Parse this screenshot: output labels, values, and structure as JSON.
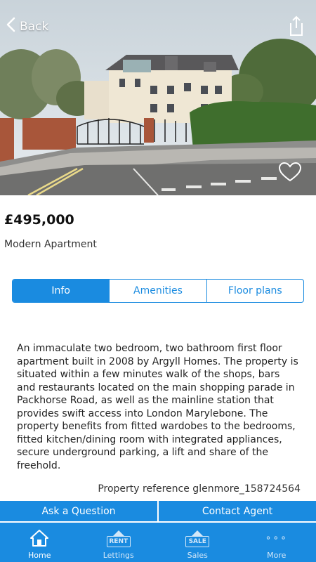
{
  "nav": {
    "back_label": "Back"
  },
  "listing": {
    "price": "£495,000",
    "type": "Modern Apartment",
    "description": "An immaculate two bedroom, two bathroom first floor apartment built in 2008 by Argyll Homes. The property is situated within a few minutes walk of the shops, bars and restaurants located on the main shopping parade in Packhorse Road, as well as the mainline station that provides swift access into London Marylebone. The property benefits from fitted wardobes to the bedrooms, fitted kitchen/dining room with integrated appliances, secure underground parking, a lift and share of the freehold.",
    "reference": "Property reference glenmore_158724564"
  },
  "tabs": [
    {
      "label": "Info",
      "active": true
    },
    {
      "label": "Amenities",
      "active": false
    },
    {
      "label": "Floor plans",
      "active": false
    }
  ],
  "actions": {
    "ask": "Ask a Question",
    "contact": "Contact Agent"
  },
  "tabbar": {
    "home": "Home",
    "lettings": "Lettings",
    "lettings_sign": "RENT",
    "sales": "Sales",
    "sales_sign": "SALE",
    "more": "More",
    "more_glyph": "∘∘∘"
  },
  "icons": {
    "back": "chevron-left-icon",
    "share": "share-icon",
    "favourite": "heart-outline-icon",
    "home": "house-icon",
    "lettings": "rent-sign-icon",
    "sales": "sale-sign-icon",
    "more": "more-dots-icon"
  },
  "colors": {
    "accent": "#1a8be0",
    "tabbar_inactive": "#d3e7f8"
  }
}
